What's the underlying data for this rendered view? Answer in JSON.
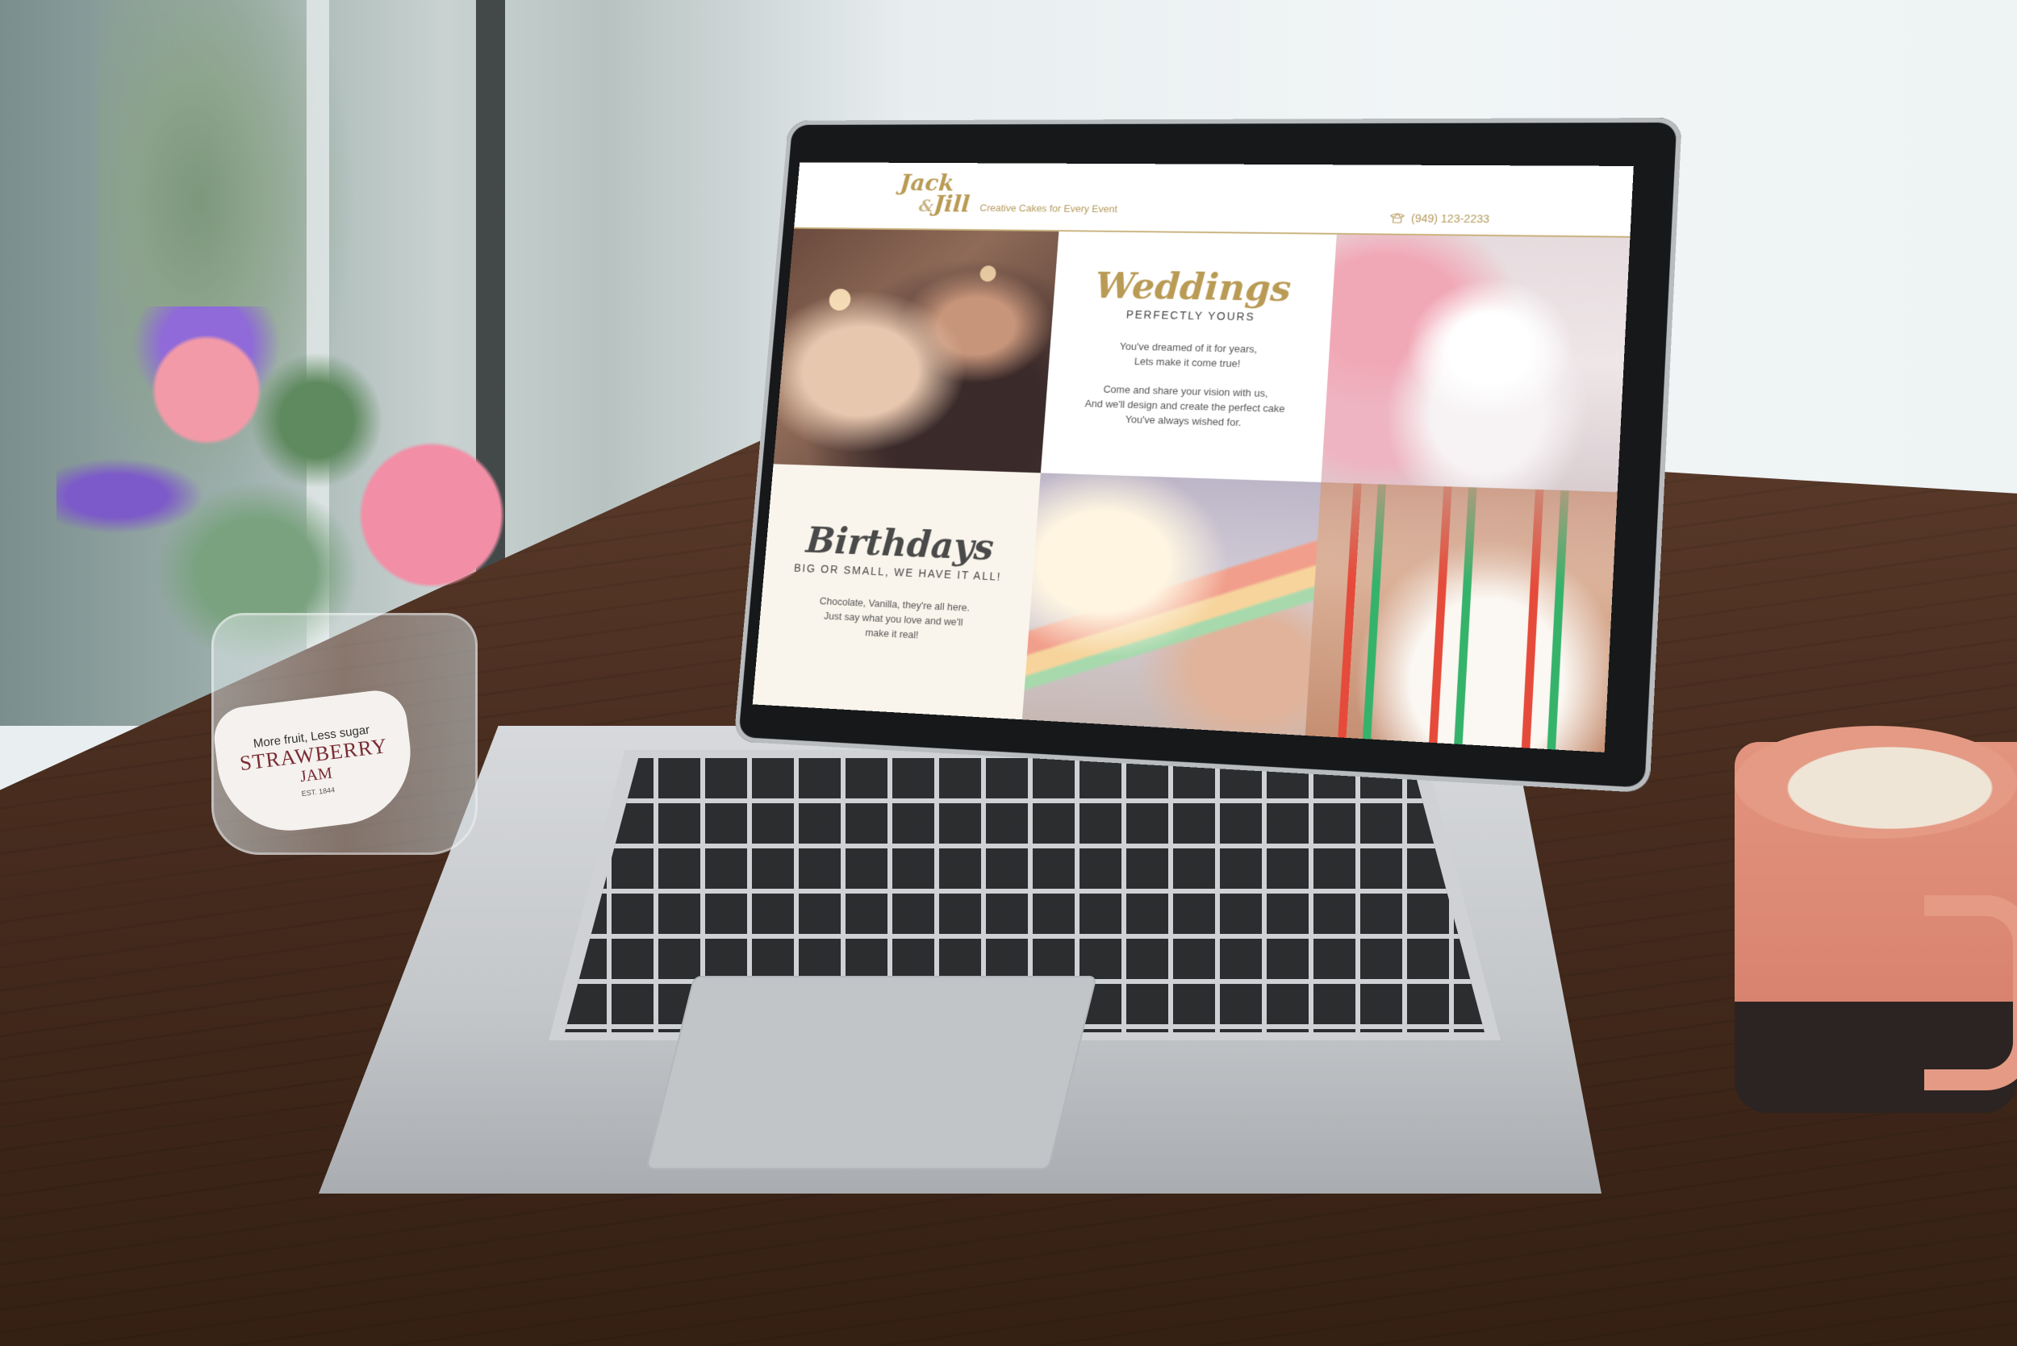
{
  "site": {
    "logo_top": "Jack",
    "logo_amp": "&",
    "logo_bottom": "Jill",
    "tagline": "Creative Cakes for Every Event",
    "phone": "(949) 123-2233"
  },
  "weddings": {
    "title": "Weddings",
    "subtitle": "PERFECTLY YOURS",
    "para1_line1": "You've dreamed of it for years,",
    "para1_line2": "Lets make it come true!",
    "para2_line1": "Come and share your vision with us,",
    "para2_line2": "And we'll design and create the perfect cake",
    "para2_line3": "You've always wished for."
  },
  "birthdays": {
    "title": "Birthdays",
    "subtitle": "BIG OR SMALL, WE HAVE IT ALL!",
    "para_line1": "Chocolate, Vanilla, they're all here.",
    "para_line2": "Just say what you love and we'll",
    "para_line3": "make it real!"
  },
  "jar_label": {
    "tagline": "More fruit, Less sugar",
    "brand": "STRAWBERRY",
    "product": "JAM",
    "est": "EST. 1844"
  },
  "colors": {
    "gold": "#b99b55",
    "cream": "#faf5ec",
    "text_dark": "#4a4a4a"
  }
}
